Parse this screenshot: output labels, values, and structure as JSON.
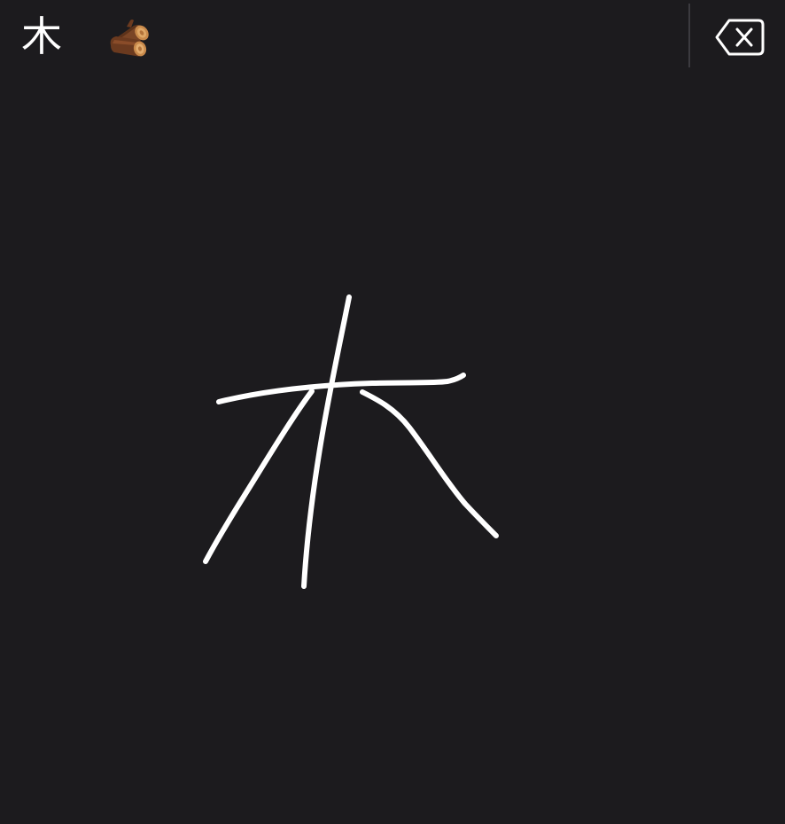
{
  "candidates": [
    {
      "text": "木",
      "kind": "character"
    },
    {
      "text": "",
      "kind": "emoji",
      "icon": "wood-log-emoji"
    }
  ],
  "delete_key": {
    "icon": "backspace-icon"
  },
  "colors": {
    "background": "#1c1b1e",
    "stroke": "#ffffff",
    "divider": "#3b3a3f"
  }
}
